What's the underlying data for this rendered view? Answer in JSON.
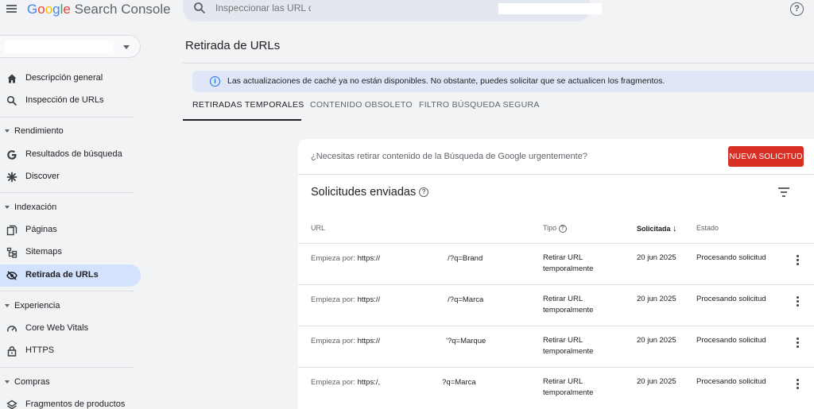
{
  "header": {
    "logo": [
      "G",
      "o",
      "o",
      "g",
      "l",
      "e"
    ],
    "product": "Search Console",
    "search_placeholder": "Inspeccionar las URL de"
  },
  "sidebar": {
    "items": [
      {
        "label": "Descripción general",
        "icon": "home-icon"
      },
      {
        "label": "Inspección de URLs",
        "icon": "search-icon"
      },
      {
        "section": "Rendimiento"
      },
      {
        "label": "Resultados de búsqueda",
        "icon": "google-g-icon"
      },
      {
        "label": "Discover",
        "icon": "asterisk-icon"
      },
      {
        "section": "Indexación"
      },
      {
        "label": "Páginas",
        "icon": "pages-icon"
      },
      {
        "label": "Sitemaps",
        "icon": "sitemap-icon"
      },
      {
        "label": "Retirada de URLs",
        "icon": "eye-off-icon",
        "active": true
      },
      {
        "section": "Experiencia"
      },
      {
        "label": "Core Web Vitals",
        "icon": "gauge-icon"
      },
      {
        "label": "HTTPS",
        "icon": "lock-icon"
      },
      {
        "section": "Compras"
      },
      {
        "label": "Fragmentos de productos",
        "icon": "layers-icon"
      }
    ]
  },
  "main": {
    "title": "Retirada de URLs",
    "banner": "Las actualizaciones de caché ya no están disponibles. No obstante, puedes solicitar que se actualicen los fragmentos.",
    "tabs": [
      "RETIRADAS TEMPORALES",
      "CONTENIDO OBSOLETO",
      "FILTRO BÚSQUEDA SEGURA"
    ],
    "card": {
      "prompt": "¿Necesitas retirar contenido de la Búsqueda de Google urgentemente?",
      "new_request": "NUEVA SOLICITUD",
      "section_title": "Solicitudes enviadas",
      "columns": {
        "url": "URL",
        "type": "Tipo",
        "requested": "Solicitada",
        "status": "Estado"
      },
      "rows": [
        {
          "prefix": "Empieza por:",
          "url_start": "https://",
          "url_end": "/?q=Brand",
          "type_1": "Retirar URL",
          "type_2": "temporalmente",
          "date": "20 jun 2025",
          "status": "Procesando solicitud"
        },
        {
          "prefix": "Empieza por:",
          "url_start": "https://",
          "url_end": "/?q=Marca",
          "type_1": "Retirar URL",
          "type_2": "temporalmente",
          "date": "20 jun 2025",
          "status": "Procesando solicitud"
        },
        {
          "prefix": "Empieza por:",
          "url_start": "https://",
          "url_end": "'?q=Marque",
          "type_1": "Retirar URL",
          "type_2": "temporalmente",
          "date": "20 jun 2025",
          "status": "Procesando solicitud"
        },
        {
          "prefix": "Empieza por:",
          "url_start": "https:/,",
          "url_end": "?q=Marca",
          "type_1": "Retirar URL",
          "type_2": "temporalmente",
          "date": "20 jun 2025",
          "status": "Procesando solicitud"
        }
      ]
    }
  },
  "colors": {
    "accent": "#1a73e8",
    "active_nav": "#d3e3fd",
    "danger": "#d93025",
    "banner": "#dfe7f7"
  }
}
